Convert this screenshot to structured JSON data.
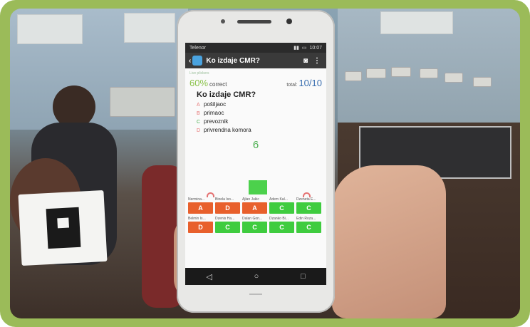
{
  "statusbar": {
    "carrier": "Telenor",
    "time": "10:07"
  },
  "appbar": {
    "back": "‹",
    "title": "Ko izdaje CMR?",
    "camera_icon": "camera-icon",
    "menu_icon": "more-vert-icon"
  },
  "quiz": {
    "small_caption": "Live plickers",
    "percent": "60%",
    "percent_label": "correct",
    "total_label": "total:",
    "total_value": "10/10",
    "question": "Ko izdaje CMR?",
    "answers": [
      {
        "letter": "A",
        "text": "pošiljaoc"
      },
      {
        "letter": "B",
        "text": "primaoc"
      },
      {
        "letter": "C",
        "text": "prevoznik"
      },
      {
        "letter": "D",
        "text": "privrendna komora"
      }
    ],
    "count": "6"
  },
  "students_row1": [
    {
      "name": "Nermina...",
      "answer": "A",
      "correct": false
    },
    {
      "name": "Binela Iso...",
      "answer": "D",
      "correct": false
    },
    {
      "name": "Ajlan Jukic",
      "answer": "A",
      "correct": false
    },
    {
      "name": "Adem Kal...",
      "answer": "C",
      "correct": true
    },
    {
      "name": "Dzeneta E...",
      "answer": "C",
      "correct": true
    }
  ],
  "students_row2": [
    {
      "name": "Belmin Is...",
      "answer": "D",
      "correct": false
    },
    {
      "name": "Dzenis Ha...",
      "answer": "C",
      "correct": true
    },
    {
      "name": "Dalan Gon...",
      "answer": "C",
      "correct": true
    },
    {
      "name": "Dzanko Bi...",
      "answer": "C",
      "correct": true
    },
    {
      "name": "Edin Roza...",
      "answer": "C",
      "correct": true
    }
  ],
  "navbar": {
    "back": "◁",
    "home": "○",
    "recent": "□"
  },
  "colors": {
    "correct": "#3fcc3f",
    "wrong": "#e8602c",
    "accent": "#8bc34a",
    "frame": "#9bbb59"
  }
}
